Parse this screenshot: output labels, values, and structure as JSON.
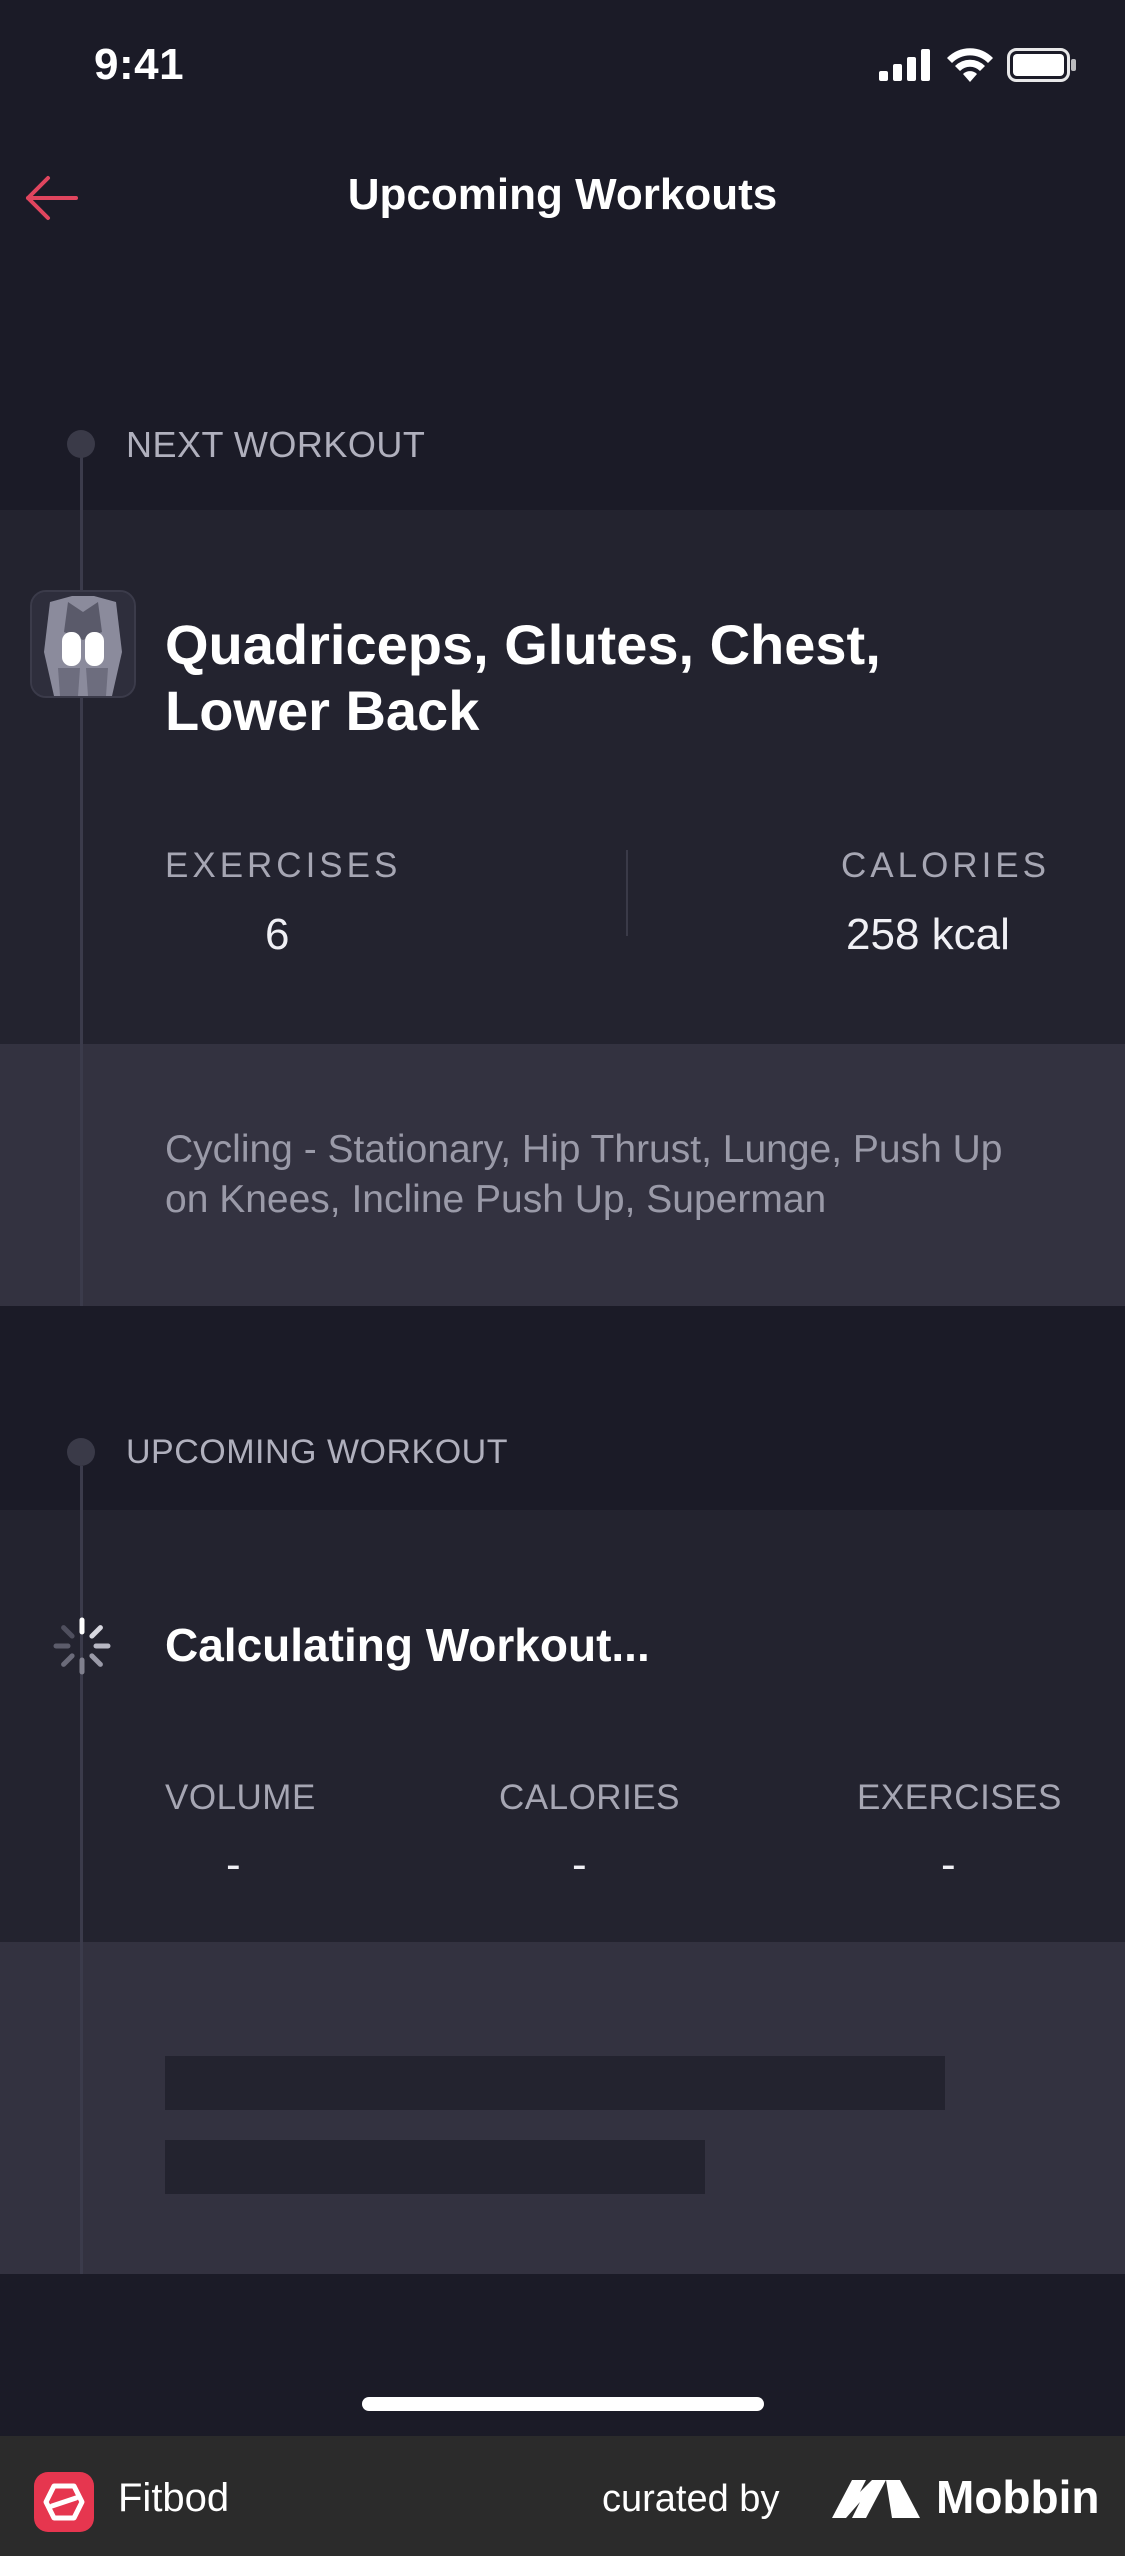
{
  "status_bar": {
    "time": "9:41"
  },
  "nav": {
    "title": "Upcoming Workouts"
  },
  "next_workout": {
    "section_label": "NEXT WORKOUT",
    "title": "Quadriceps, Glutes, Chest, Lower Back",
    "exercises_label": "EXERCISES",
    "exercises_value": "6",
    "calories_label": "CALORIES",
    "calories_value": "258 kcal",
    "exercise_list": "Cycling - Stationary, Hip Thrust, Lunge, Push Up on Knees, Incline Push Up, Superman"
  },
  "upcoming_workout": {
    "section_label": "UPCOMING WORKOUT",
    "title": "Calculating Workout...",
    "volume_label": "VOLUME",
    "volume_value": "-",
    "calories_label": "CALORIES",
    "calories_value": "-",
    "exercises_label": "EXERCISES",
    "exercises_value": "-"
  },
  "footer": {
    "app_name": "Fitbod",
    "curated_by": "curated by",
    "brand": "Mobbin"
  },
  "colors": {
    "background": "#1b1b27",
    "card": "#23232f",
    "card_secondary": "#333240",
    "accent_back": "#e0455e",
    "fitbod_red": "#e6364f"
  }
}
